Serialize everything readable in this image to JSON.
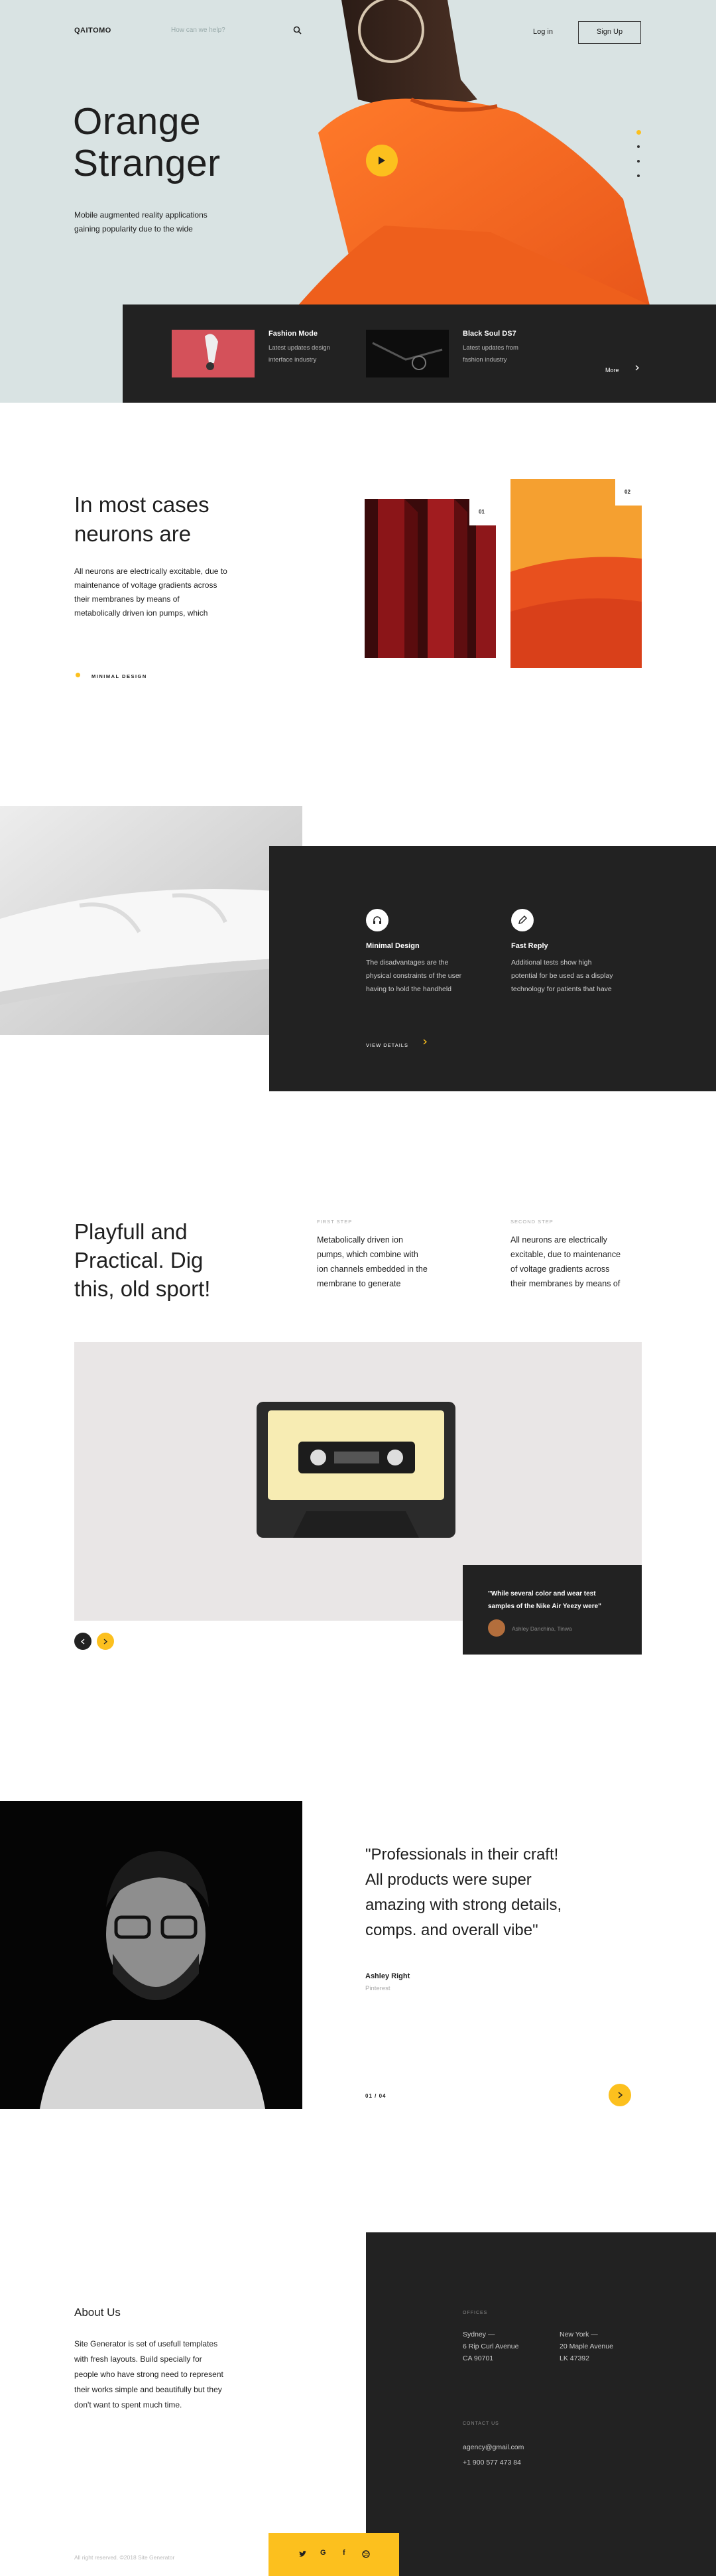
{
  "header": {
    "logo": "QAITOMO",
    "search_placeholder": "How can we help?",
    "login": "Log in",
    "signup": "Sign Up"
  },
  "hero": {
    "title_line1": "Orange",
    "title_line2": "Stranger",
    "desc_line1": "Mobile augmented reality applications",
    "desc_line2": "gaining popularity due to the wide"
  },
  "hero_slider": {
    "count": 4,
    "active_index": 0
  },
  "featured": {
    "items": [
      {
        "title": "Fashion Mode",
        "line1": "Latest updates design",
        "line2": "interface industry"
      },
      {
        "title": "Black Soul DS7",
        "line1": "Latest updates from",
        "line2": "fashion industry"
      }
    ],
    "more": "More"
  },
  "neurons": {
    "title_line1": "In most cases",
    "title_line2": "neurons are",
    "lines": [
      "All neurons are electrically excitable, due to",
      "maintenance of voltage gradients across",
      "their membranes by means of",
      "metabolically driven ion pumps, which"
    ],
    "tag": "MINIMAL DESIGN",
    "num1": "01",
    "num2": "02"
  },
  "features": {
    "items": [
      {
        "title": "Minimal Design",
        "lines": [
          "The disadvantages are the",
          "physical constraints of the user",
          "having to hold the handheld"
        ]
      },
      {
        "title": "Fast Reply",
        "lines": [
          "Additional tests show high",
          "potential for be used as a display",
          "technology for patients that have"
        ]
      }
    ],
    "view_details": "VIEW DETAILS"
  },
  "playful": {
    "title_lines": [
      "Playfull and",
      "Practical. Dig",
      "this, old sport!"
    ],
    "steps": [
      {
        "label": "FIRST STEP",
        "lines": [
          "Metabolically driven ion",
          "pumps, which combine with",
          "ion channels embedded in the",
          "membrane to generate"
        ]
      },
      {
        "label": "SECOND STEP",
        "lines": [
          "All neurons are electrically",
          "excitable, due to maintenance",
          "of voltage gradients across",
          "their membranes by means of"
        ]
      }
    ],
    "quote_line1": "\"While several color and wear test",
    "quote_line2": "samples of the Nike Air Yeezy were\"",
    "quote_author": "Ashley Danchina, Tinwa"
  },
  "testimonial": {
    "quote_lines": [
      "\"Professionals in their craft!",
      "All products were super",
      "amazing with strong details,",
      "comps. and overall vibe\""
    ],
    "author": "Ashley Right",
    "company": "Pinterest",
    "counter": "01 / 04"
  },
  "footer": {
    "about_title": "About Us",
    "about_lines": [
      "Site Generator is set of usefull templates",
      "with fresh layouts. Build specially for",
      "people who have strong need to represent",
      "their works simple and beautifully but they",
      "don't want to spent much time."
    ],
    "copyright": "All right reserved. ©2018 Site Generator",
    "offices_label": "OFFICES",
    "office1": [
      "Sydney —",
      "6 Rip Curl Avenue",
      "CA 90701"
    ],
    "office2": [
      "New York —",
      "20 Maple Avenue",
      "LK 47392"
    ],
    "contact_label": "CONTACT US",
    "email": "agency@gmail.com",
    "phone": "+1 900 577 473 84",
    "social": [
      "twitter-icon",
      "google-icon",
      "facebook-icon",
      "dribbble-icon"
    ]
  },
  "colors": {
    "accent": "#fcc01e",
    "dark": "#222222",
    "orange": "#f26a1b"
  }
}
